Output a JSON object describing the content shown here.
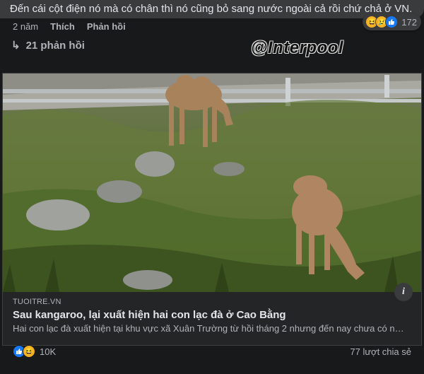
{
  "comment": {
    "text": "Đến cái cột điện nó mà có chân thì nó cũng bỏ sang nước ngoài cả rồi chứ chả ở VN.",
    "time": "2 năm",
    "like_label": "Thích",
    "reply_label": "Phản hồi",
    "reactions": {
      "icons": [
        "haha-icon",
        "sad-icon",
        "like-icon"
      ],
      "count": "172"
    },
    "replies_label": "21 phản hồi"
  },
  "watermark": "@Interpool",
  "link_card": {
    "source": "TUOITRE.VN",
    "title": "Sau kangaroo, lại xuất hiện hai con lạc đà ở Cao Bằng",
    "description": "Hai con lạc đà xuất hiện tại khu vực xã Xuân Trường từ hồi tháng 2 nhưng đến nay chưa có người ..."
  },
  "post_footer": {
    "reactions": {
      "icons": [
        "like-icon",
        "haha-icon"
      ],
      "count": "10K"
    },
    "shares": "77 lượt chia sẻ"
  },
  "colors": {
    "background": "#18191a",
    "bubble": "#3a3b3c",
    "card": "#242526",
    "primary_text": "#e4e6eb",
    "secondary_text": "#b0b3b8",
    "like_blue": "#1877f2",
    "emoji_yellow": "#f7b125"
  }
}
